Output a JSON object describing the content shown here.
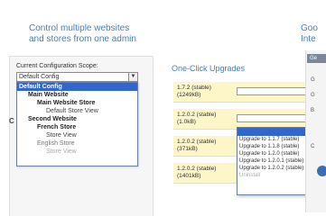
{
  "banner": {
    "left_title_line1": "Control multiple websites",
    "left_title_line2": "and stores from one admin",
    "right_title_line1": "Goo",
    "right_title_line2": "Inte"
  },
  "scope": {
    "label": "Current Configuration Scope:",
    "selected": "Default Config",
    "options": [
      "Default Config",
      "Main Website",
      "Main Website Store",
      "Default Store View",
      "Second Website",
      "French Store",
      "Store View",
      "English Store",
      "Store View"
    ]
  },
  "left_edge_char": "C",
  "upgrades": {
    "title": "One-Click Upgrades",
    "rows": [
      {
        "version": "1.7.2 (stable)",
        "size": "(1249kB)"
      },
      {
        "version": "1.2.0.2 (stable)",
        "size": "(1.0kB)"
      },
      {
        "version": "1.2.0.2 (stable)",
        "size": "(371kB)"
      },
      {
        "version": "1.2.0.2 (stable)",
        "size": "(1401kB)"
      }
    ],
    "dropdown_items": [
      "Upgrade to 1.1.7 (stable)",
      "Upgrade to 1.1.8 (stable)",
      "Upgrade to 1.2.0 (stable)",
      "Upgrade to 1.2.0.1 (stable)",
      "Upgrade to 1.2.0.2 (stable)",
      "Uninstall"
    ]
  },
  "right_panel": {
    "tab_label": "Ge",
    "letters": [
      "G",
      "G",
      "B",
      "C"
    ]
  }
}
